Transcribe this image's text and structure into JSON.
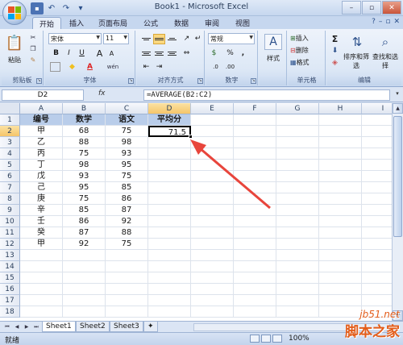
{
  "window": {
    "title": "Book1 - Microsoft Excel",
    "controls": {
      "minimize": "–",
      "maximize": "▫",
      "close": "✕"
    }
  },
  "qat": {
    "save_icon": "save-icon",
    "undo": "↶",
    "redo": "↷",
    "more": "▾"
  },
  "ribbon_tabs": [
    "开始",
    "插入",
    "页面布局",
    "公式",
    "数据",
    "审阅",
    "视图"
  ],
  "ribbon": {
    "clipboard": {
      "paste": "粘贴",
      "cut": "✂",
      "copy": "❐",
      "format_painter": "✎",
      "label": "剪贴板"
    },
    "font": {
      "name": "宋体",
      "size": "11",
      "bold": "B",
      "italic": "I",
      "underline": "U",
      "grow": "A",
      "shrink": "A",
      "wen": "wén",
      "label": "字体"
    },
    "alignment": {
      "label": "对齐方式"
    },
    "number": {
      "format": "常规",
      "percent": "%",
      "comma": ",",
      "label": "数字"
    },
    "styles": {
      "styles": "样式",
      "label": ""
    },
    "cells": {
      "insert": "插入",
      "delete": "删除",
      "format": "格式",
      "label": "单元格"
    },
    "editing": {
      "sum": "Σ",
      "sort_filter": "排序和筛选",
      "find_select": "查找和选择",
      "label": "编辑"
    }
  },
  "formula_bar": {
    "name_box": "D2",
    "fx": "fx",
    "formula": "=AVERAGE(B2:C2)"
  },
  "columns": [
    "A",
    "B",
    "C",
    "D",
    "E",
    "F",
    "G",
    "H",
    "I"
  ],
  "rows": [
    "1",
    "2",
    "3",
    "4",
    "5",
    "6",
    "7",
    "8",
    "9",
    "10",
    "11",
    "12",
    "13",
    "14",
    "15",
    "16",
    "17",
    "18"
  ],
  "table": {
    "headers": [
      "编号",
      "数学",
      "语文",
      "平均分"
    ],
    "data": [
      [
        "甲",
        "68",
        "75",
        "71.5"
      ],
      [
        "乙",
        "88",
        "98",
        ""
      ],
      [
        "丙",
        "75",
        "93",
        ""
      ],
      [
        "丁",
        "98",
        "95",
        ""
      ],
      [
        "戊",
        "93",
        "75",
        ""
      ],
      [
        "己",
        "95",
        "85",
        ""
      ],
      [
        "庚",
        "75",
        "86",
        ""
      ],
      [
        "辛",
        "85",
        "87",
        ""
      ],
      [
        "壬",
        "86",
        "92",
        ""
      ],
      [
        "癸",
        "87",
        "88",
        ""
      ],
      [
        "甲",
        "92",
        "75",
        ""
      ]
    ]
  },
  "sheets": [
    "Sheet1",
    "Sheet2",
    "Sheet3"
  ],
  "status": {
    "text": "就绪",
    "zoom": "100%"
  },
  "watermark": {
    "site": "jb51.net",
    "name": "脚本之家"
  },
  "colors": {
    "header_fill": "#b9cdea",
    "arrow": "#e8453c",
    "watermark": "#e35d1a"
  }
}
